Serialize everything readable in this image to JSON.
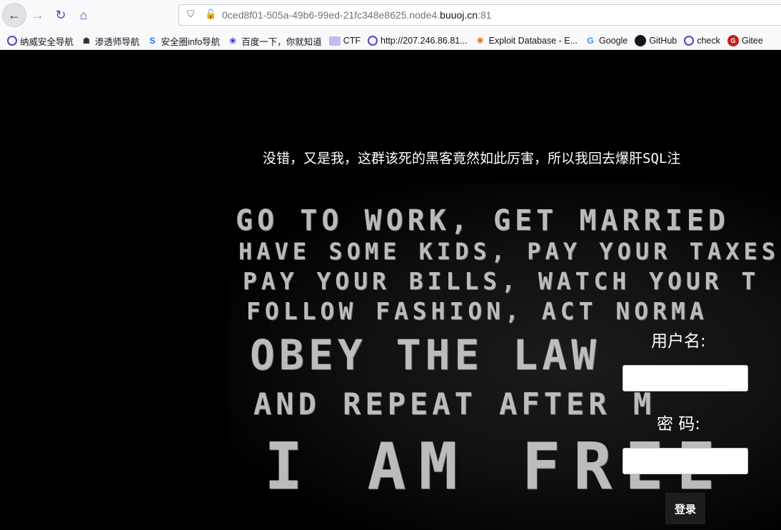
{
  "browser": {
    "url_prefix": "0ced8f01-505a-49b6-99ed-21fc348e8625.node4.",
    "url_host": "buuoj.cn",
    "url_port": ":81",
    "back_glyph": "←",
    "forward_glyph": "→",
    "reload_glyph": "↻",
    "home_glyph": "⌂",
    "bookmarks": [
      {
        "label": "纳威安全导航",
        "icon": "globe-icon"
      },
      {
        "label": "渗透师导航",
        "icon": "ninja-icon"
      },
      {
        "label": "安全圈info导航",
        "icon": "s-logo-icon"
      },
      {
        "label": "百度一下，你就知道",
        "icon": "baidu-paw-icon"
      },
      {
        "label": "CTF",
        "icon": "folder-icon"
      },
      {
        "label": "http://207.246.86.81...",
        "icon": "globe-icon"
      },
      {
        "label": "Exploit Database - E...",
        "icon": "exploit-db-icon"
      },
      {
        "label": "Google",
        "icon": "google-icon"
      },
      {
        "label": "GitHub",
        "icon": "github-icon"
      },
      {
        "label": "check",
        "icon": "globe-icon"
      },
      {
        "label": "Gitee",
        "icon": "gitee-icon"
      }
    ]
  },
  "page": {
    "headline": "没错，又是我，这群该死的黑客竟然如此厉害，所以我回去爆肝SQL注",
    "username_label": "用户名:",
    "password_label": "密 码:",
    "login_button": "登录",
    "background_text": [
      "GO TO WORK, GET MARRIED",
      "HAVE SOME KIDS, PAY YOUR TAXES",
      "PAY YOUR BILLS, WATCH YOUR T",
      "FOLLOW FASHION, ACT NORMA",
      "OBEY THE LAW",
      "AND REPEAT AFTER M",
      "I AM FREE"
    ]
  }
}
